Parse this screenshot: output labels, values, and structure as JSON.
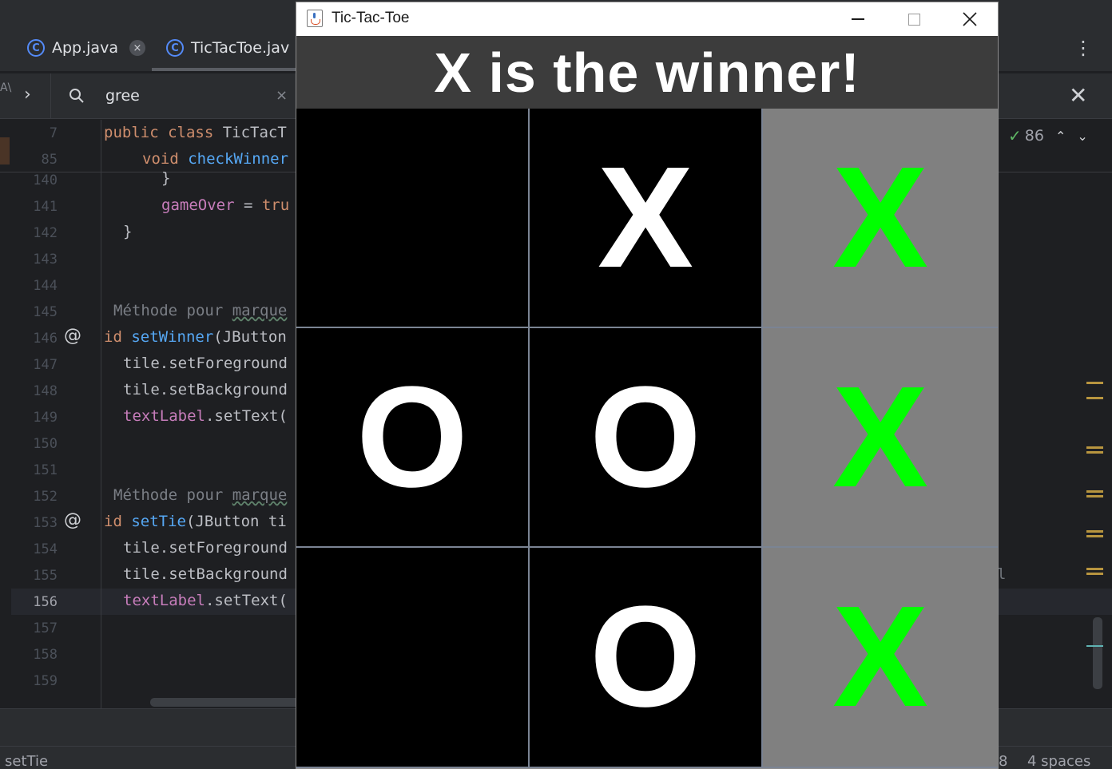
{
  "ide": {
    "tabs": [
      {
        "label": "App.java",
        "close": "×"
      },
      {
        "label": "TicTacToe.jav"
      }
    ],
    "search": {
      "value": "gree",
      "clear": "×",
      "close": "✕"
    },
    "inspection": {
      "count": "86"
    },
    "line_numbers": [
      "7",
      "85",
      "140",
      "141",
      "142",
      "143",
      "144",
      "145",
      "146",
      "147",
      "148",
      "149",
      "150",
      "151",
      "152",
      "153",
      "154",
      "155",
      "156",
      "157",
      "158",
      "159"
    ],
    "code": {
      "l7_kw": "public class ",
      "l7_rest": "TicTacT",
      "l85_kw": "void ",
      "l85_fn": "checkWinner",
      "l140": "}",
      "l141_fld": "gameOver",
      "l141_op": " = ",
      "l141_kw": "tru",
      "l142": "}",
      "l145_cmt": "Méthode pour ",
      "l145_u": "marque",
      "l146_kw": "id ",
      "l146_fn": "setWinner",
      "l146_rest": "(JButton",
      "l147": "tile.setForeground",
      "l148": "tile.setBackground",
      "l149_fld": "textLabel",
      "l149_rest": ".setText(",
      "l152_cmt": "Méthode pour ",
      "l152_u": "marque",
      "l153_kw": "id ",
      "l153_fn": "setTie",
      "l153_rest": "(JButton ti",
      "l154": "tile.setForeground",
      "l155": "tile.setBackground",
      "l156_fld": "textLabel",
      "l156_rest": ".setText("
    },
    "stray_char": "l",
    "status": {
      "left": "setTie",
      "right1": "8",
      "right2": "4 spaces"
    }
  },
  "window": {
    "title": "Tic-Tac-Toe",
    "header_text": "X is the winner!",
    "colors": {
      "header_bg": "#3c3c3c",
      "tile_bg": "#000000",
      "winner_bg": "#808080",
      "winner_fg": "#00ff00",
      "mark_fg": "#ffffff"
    },
    "tiles": [
      {
        "text": "",
        "winner": false
      },
      {
        "text": "X",
        "winner": false
      },
      {
        "text": "X",
        "winner": true
      },
      {
        "text": "O",
        "winner": false
      },
      {
        "text": "O",
        "winner": false
      },
      {
        "text": "X",
        "winner": true
      },
      {
        "text": "",
        "winner": false
      },
      {
        "text": "O",
        "winner": false
      },
      {
        "text": "X",
        "winner": true
      }
    ]
  }
}
